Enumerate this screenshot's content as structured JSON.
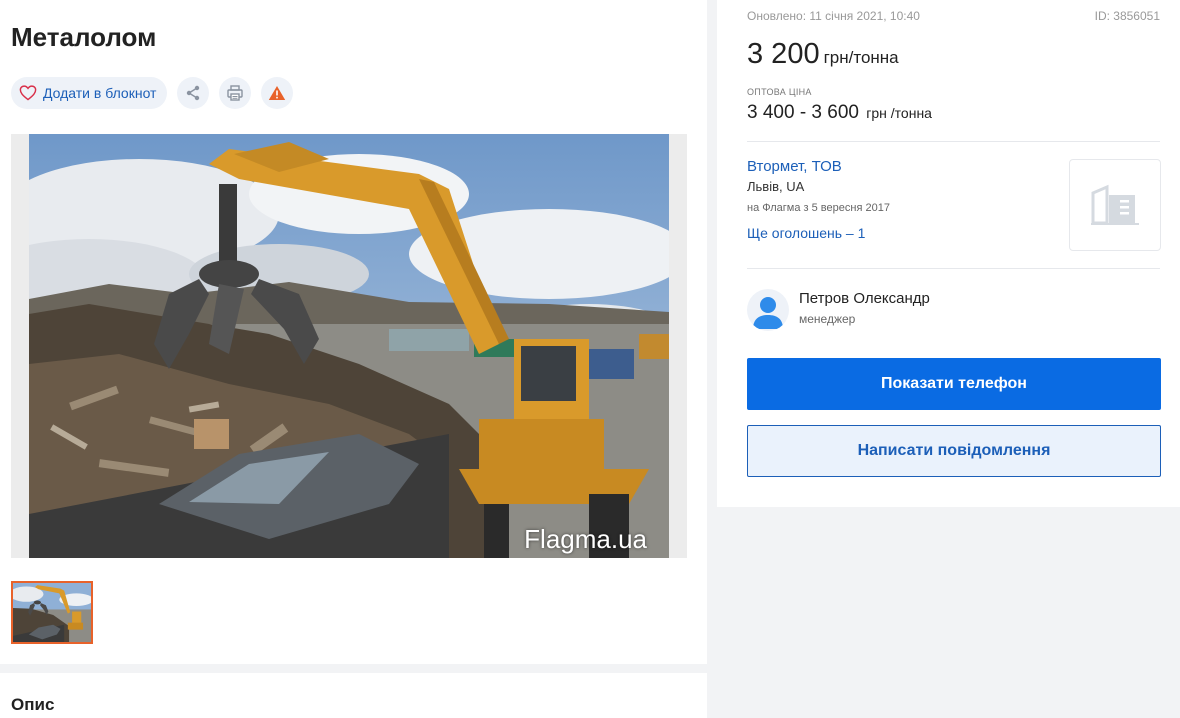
{
  "listing": {
    "title": "Металолом",
    "favorite_label": "Додати в блокнот",
    "watermark": "Flagma.ua",
    "description_title": "Опис"
  },
  "icons": {
    "heart": "heart-icon",
    "share": "share-icon",
    "print": "printer-icon",
    "report": "warning-icon",
    "company_logo": "building-icon",
    "avatar": "user-icon"
  },
  "sidebar": {
    "updated": "Оновлено: 11 січня 2021, 10:40",
    "id": "ID: 3856051",
    "price": "3 200",
    "price_unit": "грн/тонна",
    "wholesale_label": "оптова ціна",
    "wholesale_price": "3 400 - 3 600",
    "wholesale_unit": "грн /тонна",
    "company": {
      "name": "Втормет, ТОВ",
      "city": "Львів, UA",
      "since": "на Флагма з 5 вересня 2017",
      "more_ads": "Ще оголошень – 1"
    },
    "contact": {
      "name": "Петров Олександр",
      "role": "менеджер"
    },
    "show_phone": "Показати телефон",
    "write_message": "Написати повідомлення"
  },
  "colors": {
    "accent": "#0a6be3",
    "link": "#1c5fb8",
    "thumb_border": "#e8622a",
    "warning": "#e8622a"
  }
}
